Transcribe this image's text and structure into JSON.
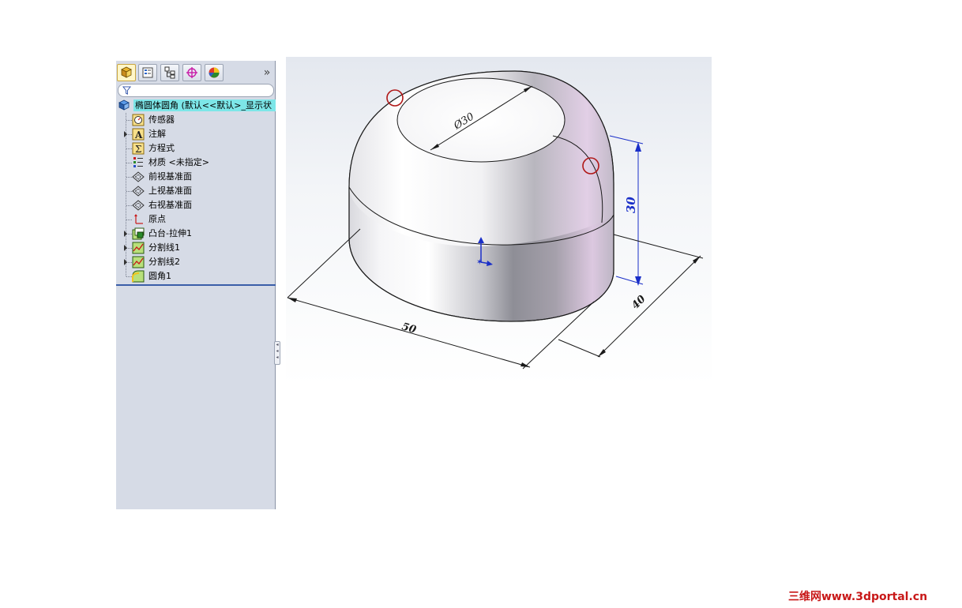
{
  "tabs": [
    {
      "name": "featuremanager-tab"
    },
    {
      "name": "propertymanager-tab"
    },
    {
      "name": "configurationmanager-tab"
    },
    {
      "name": "dimxpert-tab"
    },
    {
      "name": "display-manager-tab"
    }
  ],
  "more_label": "»",
  "root_label": "椭圆体圆角 (默认<<默认>_显示状",
  "tree": [
    {
      "label": "传感器",
      "icon": "sensor-icon",
      "expandable": false
    },
    {
      "label": "注解",
      "icon": "annotation-icon",
      "expandable": true
    },
    {
      "label": "方程式",
      "icon": "equation-icon",
      "expandable": false
    },
    {
      "label": "材质 <未指定>",
      "icon": "material-icon",
      "expandable": false
    },
    {
      "label": "前视基准面",
      "icon": "plane-icon",
      "expandable": false
    },
    {
      "label": "上视基准面",
      "icon": "plane-icon",
      "expandable": false
    },
    {
      "label": "右视基准面",
      "icon": "plane-icon",
      "expandable": false
    },
    {
      "label": "原点",
      "icon": "origin-icon",
      "expandable": false
    },
    {
      "label": "凸台-拉伸1",
      "icon": "boss-extrude-icon",
      "expandable": true
    },
    {
      "label": "分割线1",
      "icon": "split-line-icon",
      "expandable": true
    },
    {
      "label": "分割线2",
      "icon": "split-line-icon",
      "expandable": true
    },
    {
      "label": "圆角1",
      "icon": "fillet-icon",
      "expandable": false
    }
  ],
  "dimensions": {
    "diameter": "Ø30",
    "height": "30",
    "width": "50",
    "depth": "40"
  },
  "colors": {
    "tree_highlight": "#7de6e8",
    "dimension_blue": "#1a2fc8",
    "marker_red": "#b01818"
  },
  "watermark": "三维网www.3dportal.cn"
}
